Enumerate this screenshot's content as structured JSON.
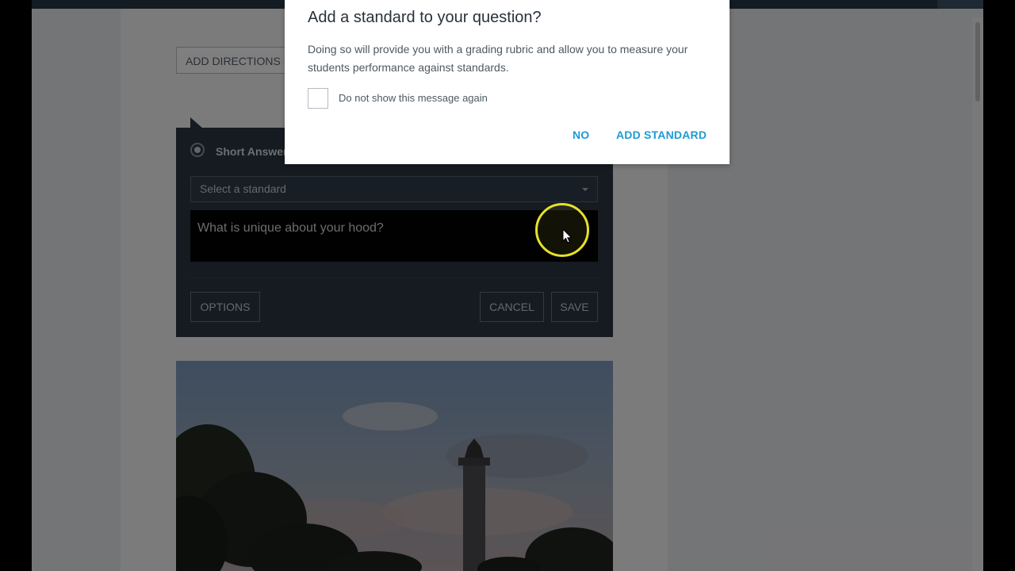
{
  "modal": {
    "title": "Add a standard to your question?",
    "body": "Doing so will provide you with a grading rubric and allow you to measure your students performance against standards.",
    "checkbox_label": "Do not show this message again",
    "no_label": "NO",
    "add_label": "ADD STANDARD"
  },
  "page": {
    "add_directions_label": "ADD DIRECTIONS I"
  },
  "editor": {
    "question_type": "Short Answer",
    "standard_placeholder": "Select a standard",
    "question_text": "What is unique about your hood?",
    "options_label": "OPTIONS",
    "cancel_label": "CANCEL",
    "save_label": "SAVE"
  },
  "colors": {
    "accent": "#1e9ad6",
    "editor_bg": "#2a3743",
    "cursor_highlight": "#e6e12a"
  },
  "icons": [
    "radio-selected-icon",
    "chevron-down-icon",
    "mouse-pointer-icon"
  ]
}
